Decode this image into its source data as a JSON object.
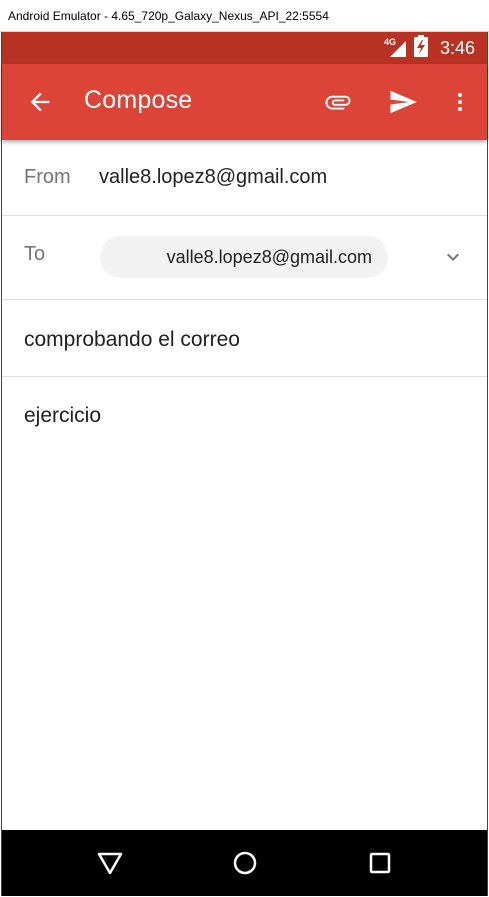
{
  "window": {
    "title": "Android Emulator - 4.65_720p_Galaxy_Nexus_API_22:5554"
  },
  "status_bar": {
    "network": "4G",
    "time": "3:46"
  },
  "app_bar": {
    "title": "Compose"
  },
  "compose": {
    "from_label": "From",
    "from_value": "valle8.lopez8@gmail.com",
    "to_label": "To",
    "to_chip": "valle8.lopez8@gmail.com",
    "subject": "comprobando el correo",
    "body": "ejercicio"
  },
  "colors": {
    "status_bar": "#b83224",
    "app_bar": "#db4437",
    "nav_bar": "#000000"
  },
  "icons": {
    "back": "arrow-left",
    "attach": "paperclip",
    "send": "send",
    "overflow": "more-vertical",
    "expand": "chevron-down",
    "nav_back": "triangle-back",
    "nav_home": "circle-home",
    "nav_recents": "square-recents"
  }
}
